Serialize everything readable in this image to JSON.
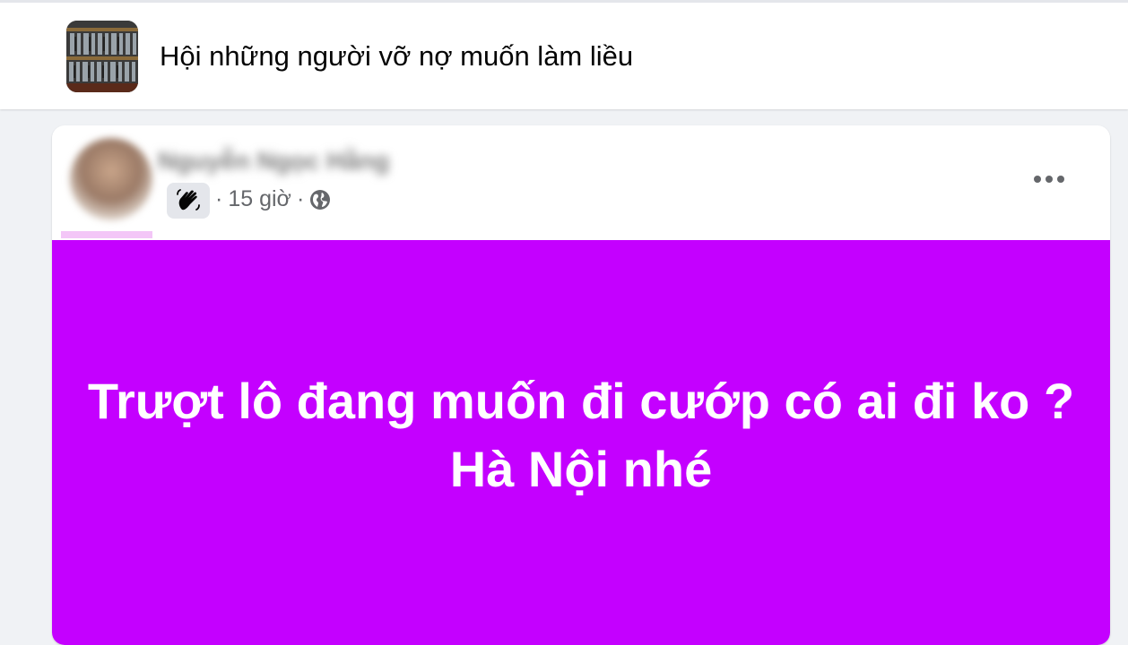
{
  "group": {
    "name": "Hội những người vỡ nợ muốn làm liều",
    "thumbnail_icon": "group-cover-image"
  },
  "post": {
    "author_name": "Nguyễn Ngọc Hằng",
    "badge_icon": "waving-hand-icon",
    "separator": "·",
    "time": "15 giờ",
    "privacy_icon": "globe-icon",
    "more_icon": "more-options-icon",
    "text": "Trượt lô đang muốn đi cướp có ai đi ko ?Hà Nội nhé",
    "background_color": "#c400ff",
    "text_color": "#ffffff"
  }
}
